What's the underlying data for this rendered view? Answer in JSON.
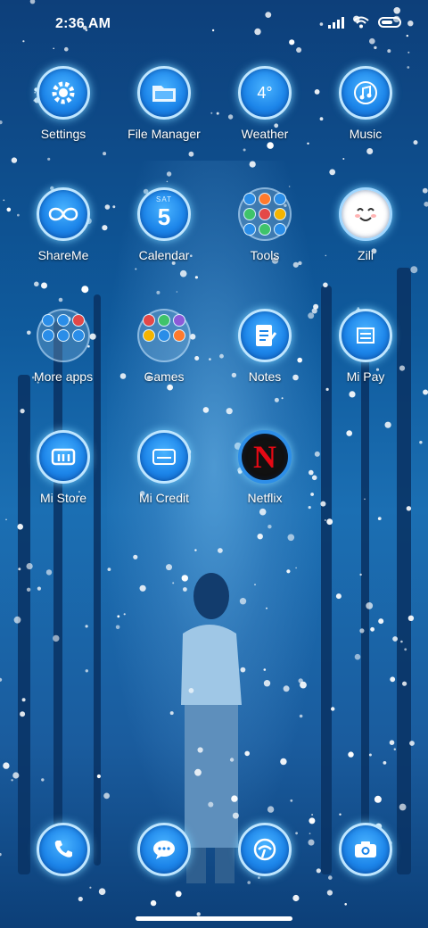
{
  "status_bar": {
    "time": "2:36 AM",
    "icons": [
      "signal-icon",
      "wifi-icon",
      "battery-icon"
    ]
  },
  "apps": [
    {
      "label": "Settings",
      "icon": "gear-icon"
    },
    {
      "label": "File Manager",
      "icon": "folder-icon"
    },
    {
      "label": "Weather",
      "icon": "weather-icon",
      "text": "4°"
    },
    {
      "label": "Music",
      "icon": "music-icon"
    },
    {
      "label": "ShareMe",
      "icon": "shareme-icon"
    },
    {
      "label": "Calendar",
      "icon": "calendar-icon",
      "day": "SAT",
      "date": "5"
    },
    {
      "label": "Tools",
      "icon": "tools-folder-icon"
    },
    {
      "label": "Zili",
      "icon": "zili-icon"
    },
    {
      "label": "More apps",
      "icon": "more-apps-folder-icon"
    },
    {
      "label": "Games",
      "icon": "games-folder-icon"
    },
    {
      "label": "Notes",
      "icon": "notes-icon"
    },
    {
      "label": "Mi Pay",
      "icon": "mi-pay-icon"
    },
    {
      "label": "Mi Store",
      "icon": "mi-store-icon"
    },
    {
      "label": "Mi Credit",
      "icon": "mi-credit-icon"
    },
    {
      "label": "Netflix",
      "icon": "netflix-icon",
      "text": "N"
    }
  ],
  "dock": [
    {
      "icon": "phone-icon"
    },
    {
      "icon": "messages-icon"
    },
    {
      "icon": "browser-icon"
    },
    {
      "icon": "camera-icon"
    }
  ],
  "colors": {
    "icon_blue": "#1d86ea",
    "icon_rim": "#bfe6ff",
    "netflix_red": "#e50914"
  }
}
